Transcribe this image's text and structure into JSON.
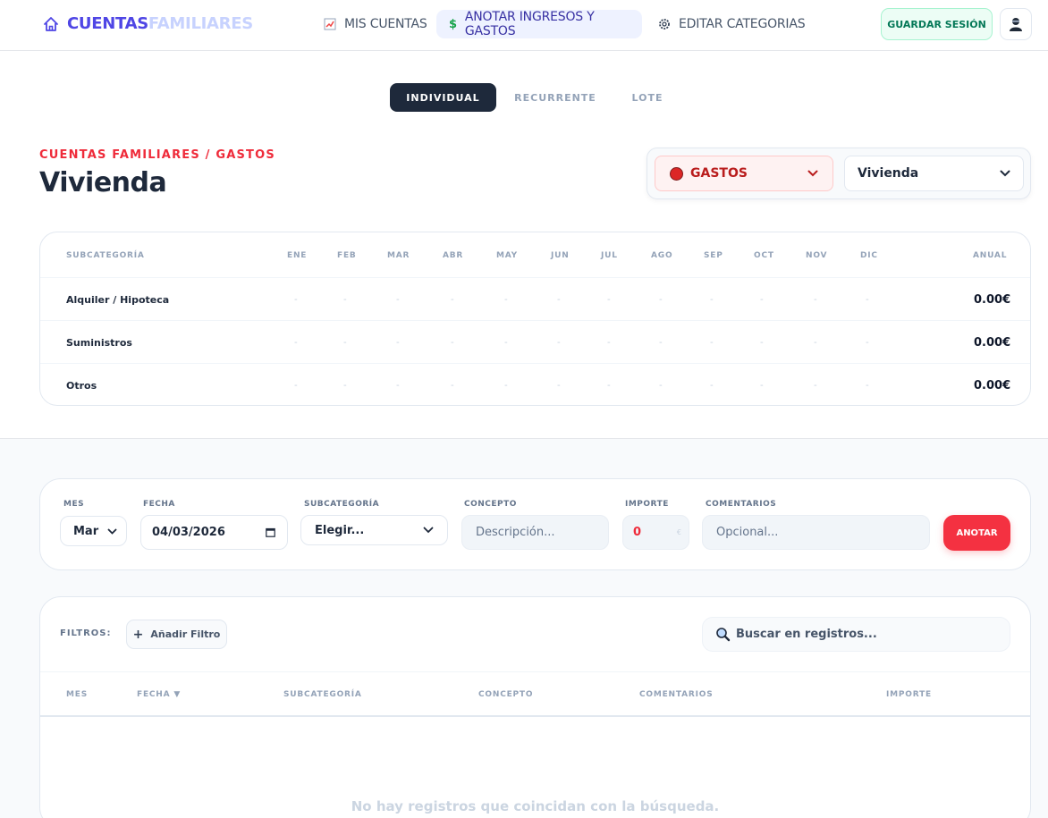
{
  "brand": {
    "part1": "CUENTAS",
    "part2": "FAMILIARES"
  },
  "nav": [
    {
      "label": "MIS CUENTAS",
      "icon": "chart-icon"
    },
    {
      "label": "ANOTAR INGRESOS Y GASTOS",
      "icon": "dollar-icon",
      "active": true
    },
    {
      "label": "EDITAR CATEGORIAS",
      "icon": "gear-icon"
    }
  ],
  "header": {
    "save_label": "GUARDAR SESIÓN"
  },
  "mode_tabs": [
    "INDIVIDUAL",
    "RECURRENTE",
    "LOTE"
  ],
  "page": {
    "breadcrumb": "CUENTAS FAMILIARES / GASTOS",
    "title": "Vivienda"
  },
  "selectors": {
    "type": "GASTOS",
    "category": "Vivienda"
  },
  "summary": {
    "columns": [
      "SUBCATEGORÍA",
      "ENE",
      "FEB",
      "MAR",
      "ABR",
      "MAY",
      "JUN",
      "JUL",
      "AGO",
      "SEP",
      "OCT",
      "NOV",
      "DIC",
      "ANUAL"
    ],
    "rows": [
      {
        "name": "Alquiler / Hipoteca",
        "months": [
          "-",
          "-",
          "-",
          "-",
          "-",
          "-",
          "-",
          "-",
          "-",
          "-",
          "-",
          "-"
        ],
        "annual": "0.00€"
      },
      {
        "name": "Suministros",
        "months": [
          "-",
          "-",
          "-",
          "-",
          "-",
          "-",
          "-",
          "-",
          "-",
          "-",
          "-",
          "-"
        ],
        "annual": "0.00€"
      },
      {
        "name": "Otros",
        "months": [
          "-",
          "-",
          "-",
          "-",
          "-",
          "-",
          "-",
          "-",
          "-",
          "-",
          "-",
          "-"
        ],
        "annual": "0.00€"
      }
    ]
  },
  "form": {
    "labels": {
      "mes": "MES",
      "fecha": "FECHA",
      "subcategoria": "SUBCATEGORÍA",
      "concepto": "CONCEPTO",
      "importe": "IMPORTE",
      "comentarios": "COMENTARIOS"
    },
    "mes_value": "Mar",
    "fecha_value": "04/03/2026",
    "subcategoria_value": "Elegir...",
    "concepto_placeholder": "Descripción...",
    "importe_value": "0",
    "importe_unit": "€",
    "comentarios_placeholder": "Opcional...",
    "submit_label": "ANOTAR"
  },
  "records": {
    "filters_label": "FILTROS:",
    "add_filter_label": "Añadir Filtro",
    "search_placeholder": "Buscar en registros...",
    "columns": [
      "MES",
      "FECHA ▼",
      "SUBCATEGORÍA",
      "CONCEPTO",
      "COMENTARIOS",
      "IMPORTE"
    ],
    "empty_message": "No hay registros que coincidan con la búsqueda."
  },
  "colors": {
    "accent": "#4f46e5",
    "expense": "#ef2b3a",
    "save": "#047857",
    "dark": "#1e293b"
  }
}
